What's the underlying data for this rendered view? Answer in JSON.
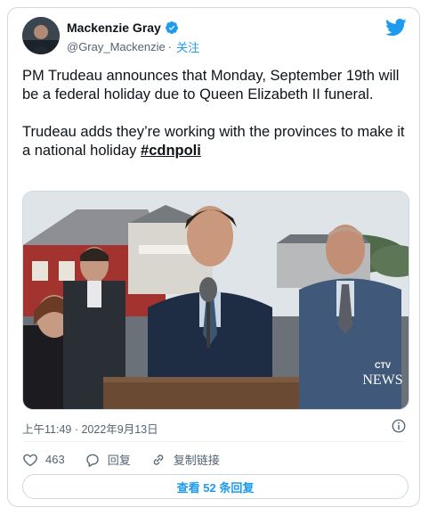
{
  "author": {
    "display_name": "Mackenzie Gray",
    "handle": "@Gray_Mackenzie",
    "separator": "·",
    "follow_label": "关注"
  },
  "tweet": {
    "paragraph1": "PM Trudeau announces that Monday, September 19th will be a federal holiday due to Queen Elizabeth II funeral.",
    "paragraph2": "Trudeau adds they’re working with the provinces to make it a national holiday ",
    "hashtag": "#cdnpoli"
  },
  "media": {
    "watermark_top": "CTV",
    "watermark_bottom": "NEWS"
  },
  "timestamp": "上午11:49 · 2022年9月13日",
  "actions": {
    "like_count": "463",
    "reply_label": "回复",
    "copy_link_label": "复制链接"
  },
  "replies_button": "查看 52 条回复",
  "colors": {
    "accent": "#1d9bf0",
    "text": "#0f1419",
    "muted": "#536471",
    "border": "#cfd9de"
  },
  "icons": [
    "verified-badge-icon",
    "twitter-bird-icon",
    "info-icon",
    "heart-icon",
    "reply-bubble-icon",
    "link-icon"
  ]
}
